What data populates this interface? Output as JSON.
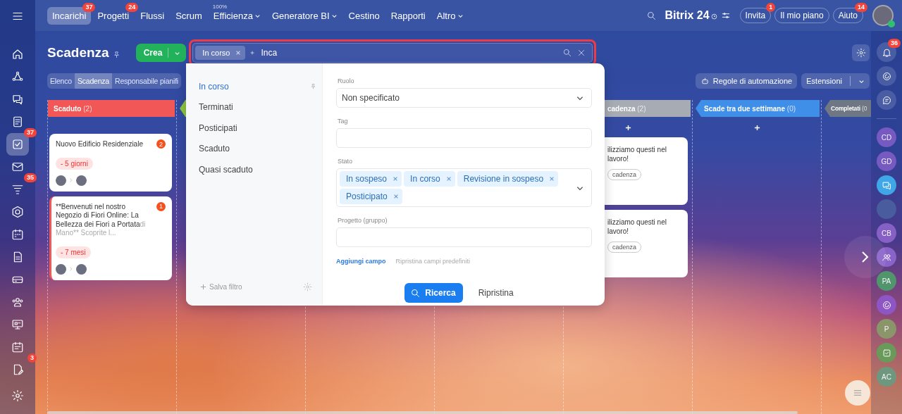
{
  "left_sidebar": {
    "items": [
      {
        "kind": "menu",
        "selected": false
      },
      {
        "kind": "home",
        "selected": false
      },
      {
        "kind": "cycle",
        "selected": false
      },
      {
        "kind": "chat",
        "selected": false
      },
      {
        "kind": "document",
        "selected": false
      },
      {
        "kind": "tasks",
        "selected": true,
        "badge": "37"
      },
      {
        "kind": "mail",
        "selected": false
      },
      {
        "kind": "funnel",
        "selected": false,
        "badge": "35"
      },
      {
        "kind": "hexagon",
        "selected": false
      },
      {
        "kind": "calendar",
        "selected": false
      },
      {
        "kind": "file",
        "selected": false
      },
      {
        "kind": "drive",
        "selected": false
      },
      {
        "kind": "people",
        "selected": false
      },
      {
        "kind": "monitor",
        "selected": false
      },
      {
        "kind": "calendar-list",
        "selected": false
      },
      {
        "kind": "edit-file",
        "selected": false,
        "badge": "3"
      },
      {
        "kind": "settings",
        "selected": false
      }
    ]
  },
  "top_bar": {
    "tabs": [
      {
        "label": "Incarichi",
        "selected": true,
        "badge": "37",
        "dropdown": false
      },
      {
        "label": "Progetti",
        "selected": false,
        "badge": "24",
        "dropdown": false
      },
      {
        "label": "Flussi",
        "selected": false,
        "dropdown": false
      },
      {
        "label": "Scrum",
        "selected": false,
        "dropdown": false
      },
      {
        "label": "Efficienza",
        "selected": false,
        "caption": "100%",
        "dropdown": true
      },
      {
        "label": "Generatore BI",
        "selected": false,
        "dropdown": true
      },
      {
        "label": "Cestino",
        "selected": false,
        "dropdown": false
      },
      {
        "label": "Rapporti",
        "selected": false,
        "dropdown": false
      },
      {
        "label": "Altro",
        "selected": false,
        "dropdown": true
      }
    ],
    "logo": "Bitrix 24",
    "buttons": [
      {
        "label": "Invita",
        "badge": "1"
      },
      {
        "label": "Il mio piano"
      },
      {
        "label": "Aiuto",
        "badge": "14"
      }
    ]
  },
  "right_sidebar": {
    "items": [
      {
        "kind": "bell",
        "badge": "36"
      },
      {
        "kind": "spiral"
      },
      {
        "kind": "chat-search"
      },
      {
        "kind": "initials",
        "text": "CD",
        "color": "#7a5bc4"
      },
      {
        "kind": "initials",
        "text": "GD",
        "color": "#7a5bc4"
      },
      {
        "kind": "chat",
        "color": "#3fa6e8"
      },
      {
        "kind": "photo"
      },
      {
        "kind": "initials",
        "text": "CB",
        "color": "#8a63c9"
      },
      {
        "kind": "group",
        "color": "#8a63c9"
      },
      {
        "kind": "initials",
        "text": "PA",
        "color": "#4f9a6a"
      },
      {
        "kind": "spiral",
        "color": "#8e55c4"
      },
      {
        "kind": "initials",
        "text": "P",
        "color": "#8a9a6a"
      },
      {
        "kind": "check",
        "color": "#6a9a5a"
      },
      {
        "kind": "initials",
        "text": "AC",
        "color": "#6a9a80"
      }
    ]
  },
  "page": {
    "title": "Scadenza",
    "create_button": "Crea",
    "search": {
      "chips": [
        "In corso"
      ],
      "value": "Inca"
    },
    "view_tabs": [
      {
        "label": "Elenco",
        "selected": false
      },
      {
        "label": "Scadenza",
        "selected": true
      },
      {
        "label": "Responsabile pianifi",
        "selected": false
      }
    ],
    "automation_button": "Regole di automazione",
    "extensions_button": "Estensioni"
  },
  "kanban": {
    "columns": [
      {
        "kind": "stage",
        "title": "Scaduto",
        "count": "(2)",
        "color": "#f25757",
        "add": false,
        "cards": [
          {
            "title": "Nuovo Edificio Residenziale",
            "counter": "2",
            "deadline": "- 5 giorni",
            "flagged": false
          },
          {
            "title": "**Benvenuti nel nostro Negozio di Fiori Online: La Bellezza dei Fiori a Portata",
            "more": "di Mano** Scoprite l...",
            "counter": "1",
            "deadline": "- 7 mesi",
            "flagged": true
          }
        ]
      },
      {
        "kind": "covered",
        "color": "#8cc63f"
      },
      {
        "kind": "covered"
      },
      {
        "kind": "covered"
      },
      {
        "kind": "stage",
        "title": "cadenza",
        "count": "(2)",
        "color": "#a7abb3",
        "add": true,
        "cards": [
          {
            "title": "ilizziamo questi nel lavoro!",
            "tag": "cadenza"
          },
          {
            "title": "ilizziamo questi nel lavoro!",
            "tag": "cadenza"
          }
        ]
      },
      {
        "kind": "stage",
        "title": "Scade tra due settimane",
        "count": "(0)",
        "color": "#3f8ee8",
        "add": true
      },
      {
        "kind": "stage",
        "title": "Completati",
        "count": "(0",
        "color": "#6f7684",
        "add": false
      }
    ]
  },
  "filter_panel": {
    "presets": [
      {
        "label": "In corso",
        "selected": true
      },
      {
        "label": "Terminati",
        "selected": false
      },
      {
        "label": "Posticipati",
        "selected": false
      },
      {
        "label": "Scaduto",
        "selected": false
      },
      {
        "label": "Quasi scaduto",
        "selected": false
      }
    ],
    "save_filter": "Salva filtro",
    "fields": [
      {
        "kind": "select",
        "label": "Ruolo",
        "value": "Non specificato"
      },
      {
        "kind": "text",
        "label": "Tag"
      },
      {
        "kind": "multiselect",
        "label": "Stato",
        "chips": [
          "In sospeso",
          "In corso",
          "Revisione in sospeso",
          "Posticipato"
        ]
      },
      {
        "kind": "text",
        "label": "Progetto (gruppo)"
      }
    ],
    "add_field": "Aggiungi campo",
    "reset_fields": "Ripristina campi predefiniti",
    "search_button": "Ricerca",
    "reset_button": "Ripristina"
  }
}
